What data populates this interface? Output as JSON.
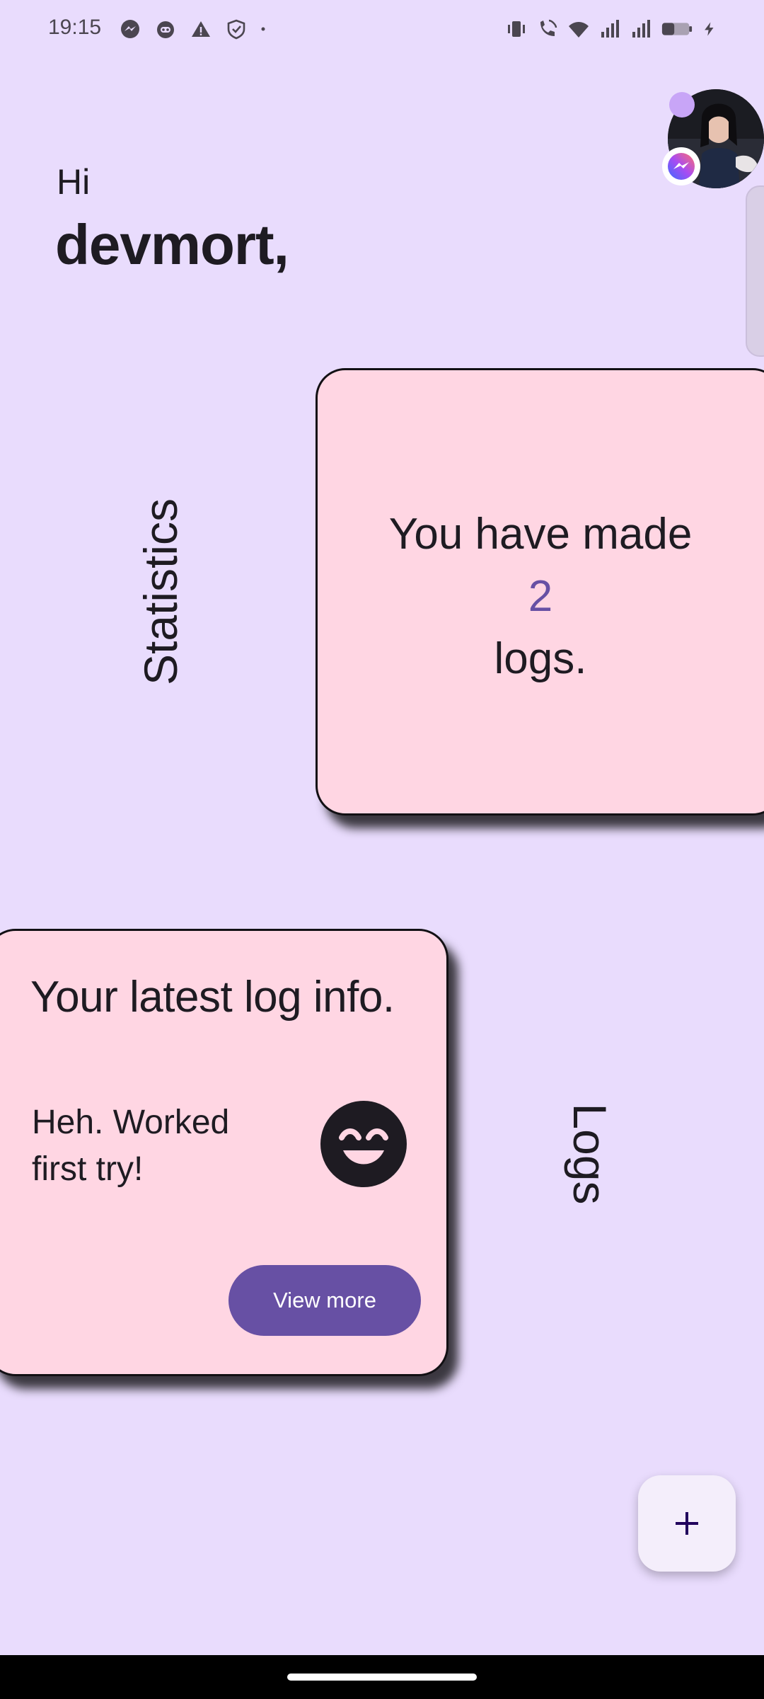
{
  "status_bar": {
    "time": "19:15",
    "left_icons": [
      "messenger-icon",
      "cat-face-icon",
      "warning-icon",
      "shield-check-icon",
      "dot-icon"
    ],
    "right_icons": [
      "vibrate-icon",
      "wifi-calling-icon",
      "wifi-icon",
      "signal-icon",
      "signal-icon",
      "battery-icon",
      "charging-bolt-icon"
    ]
  },
  "greeting": {
    "hi": "Hi",
    "name": "devmort,"
  },
  "statistics": {
    "section_label": "Statistics",
    "line1": "You have made",
    "count": "2",
    "line3": "logs."
  },
  "logs": {
    "section_label": "Logs",
    "card_title": "Your latest log info.",
    "latest_text": "Heh. Worked first try!",
    "mood_icon": "smiling-face-icon",
    "view_more_label": "View more"
  },
  "fab": {
    "icon": "plus-icon"
  },
  "colors": {
    "background": "#e9dcfd",
    "card": "#ffd6e3",
    "accent": "#6750a4",
    "text": "#1e1b22"
  }
}
